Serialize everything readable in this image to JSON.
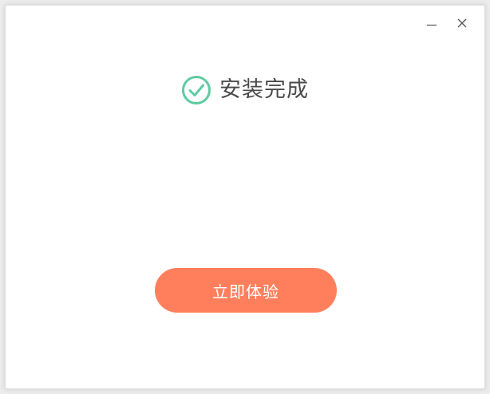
{
  "window": {
    "controls": {
      "minimize_icon": "minimize-icon",
      "close_icon": "close-icon"
    }
  },
  "status": {
    "icon": "check-circle-icon",
    "icon_color": "#5ecba1",
    "title": "安装完成"
  },
  "action": {
    "button_label": "立即体验",
    "button_color": "#ff7f5c"
  }
}
